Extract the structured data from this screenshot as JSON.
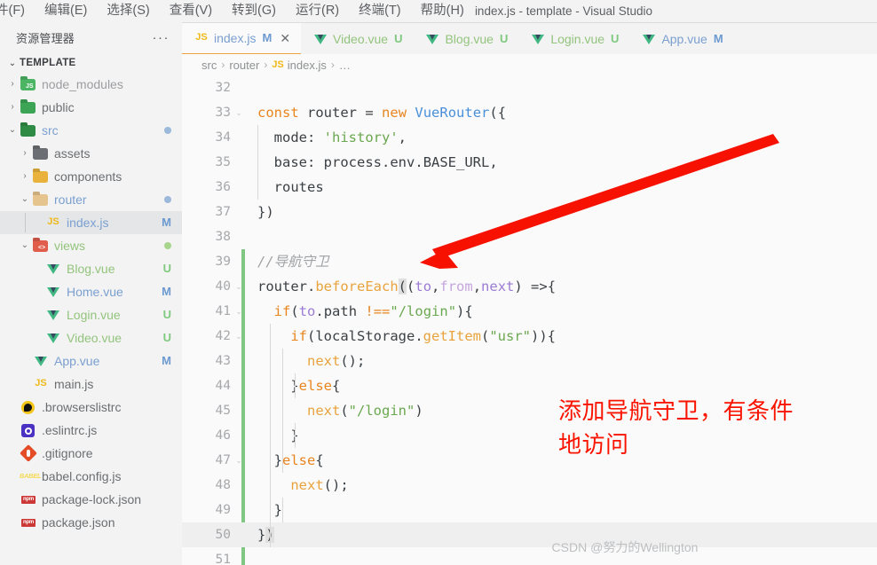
{
  "window": {
    "title": "index.js - template - Visual Studio",
    "menu": [
      {
        "label": "件(F)",
        "name": "menu-file"
      },
      {
        "label": "编辑(E)",
        "name": "menu-edit"
      },
      {
        "label": "选择(S)",
        "name": "menu-selection"
      },
      {
        "label": "查看(V)",
        "name": "menu-view"
      },
      {
        "label": "转到(G)",
        "name": "menu-goto"
      },
      {
        "label": "运行(R)",
        "name": "menu-run"
      },
      {
        "label": "终端(T)",
        "name": "menu-terminal"
      },
      {
        "label": "帮助(H)",
        "name": "menu-help"
      }
    ]
  },
  "sidebar": {
    "header_title": "资源管理器",
    "more_actions": "···",
    "section_label": "TEMPLATE",
    "tree": [
      {
        "label": "node_modules",
        "indent": 1,
        "twisty": "chevron-right",
        "icon": "folder-node-modules",
        "badge": "",
        "dot": "",
        "labelClass": "dim",
        "selected": false
      },
      {
        "label": "public",
        "indent": 1,
        "twisty": "chevron-right",
        "icon": "folder-public",
        "badge": "",
        "dot": "",
        "labelClass": "",
        "selected": false
      },
      {
        "label": "src",
        "indent": 1,
        "twisty": "chevron-down",
        "icon": "folder-src",
        "badge": "",
        "dot": "blue",
        "labelClass": "blue",
        "selected": false
      },
      {
        "label": "assets",
        "indent": 2,
        "twisty": "chevron-right",
        "icon": "folder-assets",
        "badge": "",
        "dot": "",
        "labelClass": "",
        "selected": false
      },
      {
        "label": "components",
        "indent": 2,
        "twisty": "chevron-right",
        "icon": "folder-components",
        "badge": "",
        "dot": "",
        "labelClass": "",
        "selected": false
      },
      {
        "label": "router",
        "indent": 2,
        "twisty": "chevron-down",
        "icon": "folder-router",
        "badge": "",
        "dot": "blue",
        "labelClass": "blue",
        "selected": false
      },
      {
        "label": "index.js",
        "indent": 3,
        "twisty": "",
        "icon": "js-file",
        "badge": "M",
        "dot": "",
        "labelClass": "blue",
        "selected": true
      },
      {
        "label": "views",
        "indent": 2,
        "twisty": "chevron-down",
        "icon": "folder-views",
        "badge": "",
        "dot": "green",
        "labelClass": "green",
        "selected": false
      },
      {
        "label": "Blog.vue",
        "indent": 3,
        "twisty": "",
        "icon": "vue-file",
        "badge": "U",
        "dot": "",
        "labelClass": "green",
        "selected": false
      },
      {
        "label": "Home.vue",
        "indent": 3,
        "twisty": "",
        "icon": "vue-file",
        "badge": "M",
        "dot": "",
        "labelClass": "blue",
        "selected": false
      },
      {
        "label": "Login.vue",
        "indent": 3,
        "twisty": "",
        "icon": "vue-file",
        "badge": "U",
        "dot": "",
        "labelClass": "green",
        "selected": false
      },
      {
        "label": "Video.vue",
        "indent": 3,
        "twisty": "",
        "icon": "vue-file",
        "badge": "U",
        "dot": "",
        "labelClass": "green",
        "selected": false
      },
      {
        "label": "App.vue",
        "indent": 2,
        "twisty": "",
        "icon": "vue-file",
        "badge": "M",
        "dot": "",
        "labelClass": "blue",
        "selected": false
      },
      {
        "label": "main.js",
        "indent": 2,
        "twisty": "",
        "icon": "js-file",
        "badge": "",
        "dot": "",
        "labelClass": "",
        "selected": false
      },
      {
        "label": ".browserslistrc",
        "indent": 1,
        "twisty": "",
        "icon": "browserslist-file",
        "badge": "",
        "dot": "",
        "labelClass": "",
        "selected": false
      },
      {
        "label": ".eslintrc.js",
        "indent": 1,
        "twisty": "",
        "icon": "eslint-file",
        "badge": "",
        "dot": "",
        "labelClass": "",
        "selected": false
      },
      {
        "label": ".gitignore",
        "indent": 1,
        "twisty": "",
        "icon": "git-file",
        "badge": "",
        "dot": "",
        "labelClass": "",
        "selected": false
      },
      {
        "label": "babel.config.js",
        "indent": 1,
        "twisty": "",
        "icon": "babel-file",
        "badge": "",
        "dot": "",
        "labelClass": "",
        "selected": false
      },
      {
        "label": "package-lock.json",
        "indent": 1,
        "twisty": "",
        "icon": "npm-file",
        "badge": "",
        "dot": "",
        "labelClass": "",
        "selected": false
      },
      {
        "label": "package.json",
        "indent": 1,
        "twisty": "",
        "icon": "npm-file",
        "badge": "",
        "dot": "",
        "labelClass": "",
        "selected": false
      }
    ]
  },
  "tabs": [
    {
      "label": "index.js",
      "icon": "js-file",
      "badge": "M",
      "badgeClass": "m",
      "labelClass": "",
      "active": true,
      "close": "✕"
    },
    {
      "label": "Video.vue",
      "icon": "vue-file",
      "badge": "U",
      "badgeClass": "u",
      "labelClass": "green",
      "active": false,
      "close": ""
    },
    {
      "label": "Blog.vue",
      "icon": "vue-file",
      "badge": "U",
      "badgeClass": "u",
      "labelClass": "green",
      "active": false,
      "close": ""
    },
    {
      "label": "Login.vue",
      "icon": "vue-file",
      "badge": "U",
      "badgeClass": "u",
      "labelClass": "green",
      "active": false,
      "close": ""
    },
    {
      "label": "App.vue",
      "icon": "vue-file",
      "badge": "M",
      "badgeClass": "m",
      "labelClass": "",
      "active": false,
      "close": ""
    }
  ],
  "breadcrumb": {
    "segments": [
      "src",
      "router",
      "index.js",
      "…"
    ],
    "separator": "›",
    "file_icon_label": "JS"
  },
  "code": {
    "first_visible_line": 32,
    "cursor_line": 50,
    "git_change_from": 39,
    "git_change_to": 51,
    "lines": [
      {
        "n": "32",
        "fold": "",
        "cursor": false,
        "tokens": []
      },
      {
        "n": "33",
        "fold": "chevron-down",
        "cursor": false,
        "tokens": [
          {
            "t": "const",
            "c": "k-const"
          },
          {
            "t": " ",
            "c": "k-plain"
          },
          {
            "t": "router",
            "c": "k-ident"
          },
          {
            "t": " ",
            "c": "k-plain"
          },
          {
            "t": "=",
            "c": "k-op"
          },
          {
            "t": " ",
            "c": "k-plain"
          },
          {
            "t": "new",
            "c": "k-const"
          },
          {
            "t": " ",
            "c": "k-plain"
          },
          {
            "t": "VueRouter",
            "c": "k-class"
          },
          {
            "t": "({",
            "c": "k-plain"
          }
        ]
      },
      {
        "n": "34",
        "fold": "",
        "cursor": false,
        "tokens": [
          {
            "t": "  mode",
            "c": "k-plain"
          },
          {
            "t": ": ",
            "c": "k-plain"
          },
          {
            "t": "'history'",
            "c": "k-str"
          },
          {
            "t": ",",
            "c": "k-plain"
          }
        ]
      },
      {
        "n": "35",
        "fold": "",
        "cursor": false,
        "tokens": [
          {
            "t": "  base",
            "c": "k-plain"
          },
          {
            "t": ": ",
            "c": "k-plain"
          },
          {
            "t": "process",
            "c": "k-plain"
          },
          {
            "t": ".",
            "c": "k-op"
          },
          {
            "t": "env",
            "c": "k-plain"
          },
          {
            "t": ".",
            "c": "k-op"
          },
          {
            "t": "BASE_URL",
            "c": "k-plain"
          },
          {
            "t": ",",
            "c": "k-plain"
          }
        ]
      },
      {
        "n": "36",
        "fold": "",
        "cursor": false,
        "tokens": [
          {
            "t": "  routes",
            "c": "k-plain"
          }
        ]
      },
      {
        "n": "37",
        "fold": "",
        "cursor": false,
        "tokens": [
          {
            "t": "})",
            "c": "k-plain"
          }
        ]
      },
      {
        "n": "38",
        "fold": "",
        "cursor": false,
        "tokens": []
      },
      {
        "n": "39",
        "fold": "",
        "cursor": false,
        "tokens": [
          {
            "t": "//导航守卫",
            "c": "k-cmt"
          }
        ]
      },
      {
        "n": "40",
        "fold": "chevron-down",
        "cursor": false,
        "tokens": [
          {
            "t": "router",
            "c": "k-plain"
          },
          {
            "t": ".",
            "c": "k-op"
          },
          {
            "t": "beforeEach",
            "c": "k-fn"
          },
          {
            "t": "(",
            "c": "hl-brace k-plain"
          },
          {
            "t": "(",
            "c": "k-plain"
          },
          {
            "t": "to",
            "c": "k-param"
          },
          {
            "t": ",",
            "c": "k-plain"
          },
          {
            "t": "from",
            "c": "k-dim"
          },
          {
            "t": ",",
            "c": "k-plain"
          },
          {
            "t": "next",
            "c": "k-param"
          },
          {
            "t": ") ",
            "c": "k-plain"
          },
          {
            "t": "=>",
            "c": "k-op"
          },
          {
            "t": "{",
            "c": "k-plain"
          }
        ]
      },
      {
        "n": "41",
        "fold": "chevron-down",
        "cursor": false,
        "tokens": [
          {
            "t": "  ",
            "c": "k-plain"
          },
          {
            "t": "if",
            "c": "k-const"
          },
          {
            "t": "(",
            "c": "k-plain"
          },
          {
            "t": "to",
            "c": "k-param"
          },
          {
            "t": ".",
            "c": "k-op"
          },
          {
            "t": "path",
            "c": "k-plain"
          },
          {
            "t": " ",
            "c": "k-plain"
          },
          {
            "t": "!==",
            "c": "k-const"
          },
          {
            "t": "\"/login\"",
            "c": "k-str"
          },
          {
            "t": "){",
            "c": "k-plain"
          }
        ]
      },
      {
        "n": "42",
        "fold": "chevron-down",
        "cursor": false,
        "tokens": [
          {
            "t": "    ",
            "c": "k-plain"
          },
          {
            "t": "if",
            "c": "k-const"
          },
          {
            "t": "(",
            "c": "k-plain"
          },
          {
            "t": "localStorage",
            "c": "k-plain"
          },
          {
            "t": ".",
            "c": "k-op"
          },
          {
            "t": "getItem",
            "c": "k-fn"
          },
          {
            "t": "(",
            "c": "k-plain"
          },
          {
            "t": "\"usr\"",
            "c": "k-str"
          },
          {
            "t": ")){",
            "c": "k-plain"
          }
        ]
      },
      {
        "n": "43",
        "fold": "",
        "cursor": false,
        "tokens": [
          {
            "t": "      ",
            "c": "k-plain"
          },
          {
            "t": "next",
            "c": "k-fn"
          },
          {
            "t": "();",
            "c": "k-plain"
          }
        ]
      },
      {
        "n": "44",
        "fold": "",
        "cursor": false,
        "tokens": [
          {
            "t": "    }",
            "c": "k-plain"
          },
          {
            "t": "else",
            "c": "k-const"
          },
          {
            "t": "{",
            "c": "k-plain"
          }
        ]
      },
      {
        "n": "45",
        "fold": "",
        "cursor": false,
        "tokens": [
          {
            "t": "      ",
            "c": "k-plain"
          },
          {
            "t": "next",
            "c": "k-fn"
          },
          {
            "t": "(",
            "c": "k-plain"
          },
          {
            "t": "\"/login\"",
            "c": "k-str"
          },
          {
            "t": ")",
            "c": "k-plain"
          }
        ]
      },
      {
        "n": "46",
        "fold": "",
        "cursor": false,
        "tokens": [
          {
            "t": "    }",
            "c": "k-plain"
          }
        ]
      },
      {
        "n": "47",
        "fold": "chevron-down",
        "cursor": false,
        "tokens": [
          {
            "t": "  }",
            "c": "k-plain"
          },
          {
            "t": "else",
            "c": "k-const"
          },
          {
            "t": "{",
            "c": "k-plain"
          }
        ]
      },
      {
        "n": "48",
        "fold": "",
        "cursor": false,
        "tokens": [
          {
            "t": "    ",
            "c": "k-plain"
          },
          {
            "t": "next",
            "c": "k-fn"
          },
          {
            "t": "();",
            "c": "k-plain"
          }
        ]
      },
      {
        "n": "49",
        "fold": "",
        "cursor": false,
        "tokens": [
          {
            "t": "  }",
            "c": "k-plain"
          }
        ]
      },
      {
        "n": "50",
        "fold": "",
        "cursor": true,
        "tokens": [
          {
            "t": "}",
            "c": "k-plain"
          },
          {
            "t": ")",
            "c": "hl-brace k-plain"
          }
        ]
      },
      {
        "n": "51",
        "fold": "",
        "cursor": false,
        "tokens": []
      }
    ]
  },
  "annotation": {
    "note_line1": "添加导航守卫，有条件",
    "note_line2": "地访问",
    "note_color": "#fa1400",
    "arrow_color": "#f71100"
  },
  "watermark": "CSDN @努力的Wellington"
}
